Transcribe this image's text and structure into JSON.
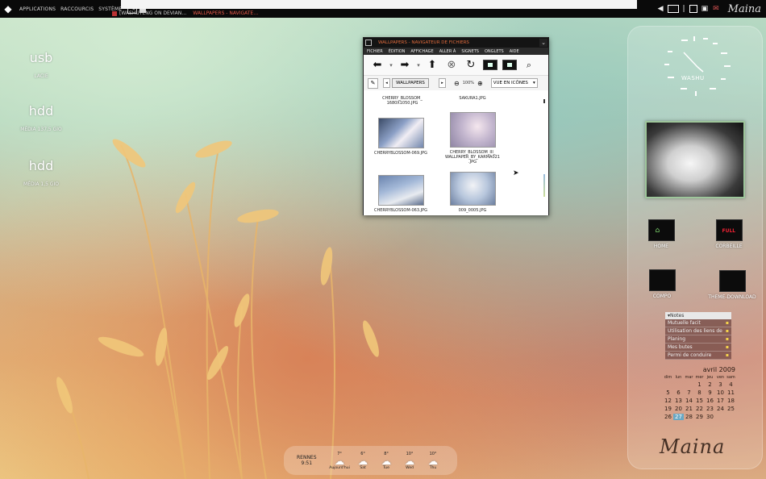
{
  "top_panel": {
    "menus": [
      "APPLICATIONS",
      "RACCOURCIS",
      "SYSTÈME"
    ],
    "tasks": [
      {
        "label": "[WASHUTENG ON DEVIAN…",
        "active": false
      },
      {
        "label": "WALLPAPERS - NAVIGATE…",
        "active": true
      }
    ],
    "brand": "Maina"
  },
  "desktop_icons": [
    {
      "glyph": "usb",
      "label": "LACIE"
    },
    {
      "glyph": "hdd",
      "label": "MÉDIA 137,5 GIO"
    },
    {
      "glyph": "hdd",
      "label": "MÉDIA 1,5 GIO"
    }
  ],
  "file_manager": {
    "title": "WALLPAPERS - NAVIGATEUR DE FICHIERS",
    "menus": [
      "FICHIER",
      "ÉDITION",
      "AFFICHAGE",
      "ALLER À",
      "SIGNETS",
      "ONGLETS",
      "AIDE"
    ],
    "path": "WALLPAPERS",
    "zoom": "100%",
    "view_mode": "VUE EN ICÔNES",
    "files": [
      {
        "name": "CHERRY_BLOSSOM_\n1680X1050.JPG",
        "partial": true
      },
      {
        "name": "SAKURA1.JPG",
        "partial": true
      },
      {
        "name": "CHERRYBLOSSOM-069.JPG"
      },
      {
        "name": "CHERRY_BLOSSOM_III_\nWALLPAPER_BY_KARMA021\n.JPG"
      },
      {
        "name": "CHERRYBLOSSOM-063.JPG"
      },
      {
        "name": "009_0005.JPG"
      }
    ]
  },
  "dock": {
    "clock_label": "WASHU",
    "folders": [
      {
        "label": "HOME"
      },
      {
        "label": "CORBEILLE",
        "badge": "FULL"
      },
      {
        "label": "COMPO"
      },
      {
        "label": "THEME-DOWNLOAD"
      }
    ],
    "notes": {
      "header": "▾Notes",
      "items": [
        "Mutuelle facit",
        "Utilisation des liens de",
        "Planing",
        "Mes butes",
        "Permi de conduire"
      ]
    },
    "calendar": {
      "title": "avril 2009",
      "dow": [
        "dim",
        "lun",
        "mar",
        "mer",
        "jeu",
        "ven",
        "sam"
      ],
      "days": [
        "",
        "",
        "",
        "1",
        "2",
        "3",
        "4",
        "5",
        "6",
        "7",
        "8",
        "9",
        "10",
        "11",
        "12",
        "13",
        "14",
        "15",
        "16",
        "17",
        "18",
        "19",
        "20",
        "21",
        "22",
        "23",
        "24",
        "25",
        "26",
        "27",
        "28",
        "29",
        "30",
        "",
        ""
      ],
      "today": "27"
    },
    "brand": "Maina"
  },
  "weather": {
    "city": "RENNES",
    "time": "9:51",
    "forecast": [
      {
        "temp": "7°",
        "day": "Aujourd'hui"
      },
      {
        "temp": "6°",
        "day": "Sat"
      },
      {
        "temp": "8°",
        "day": "Tue"
      },
      {
        "temp": "10°",
        "day": "Wed"
      },
      {
        "temp": "10°",
        "day": "Thu"
      }
    ]
  }
}
